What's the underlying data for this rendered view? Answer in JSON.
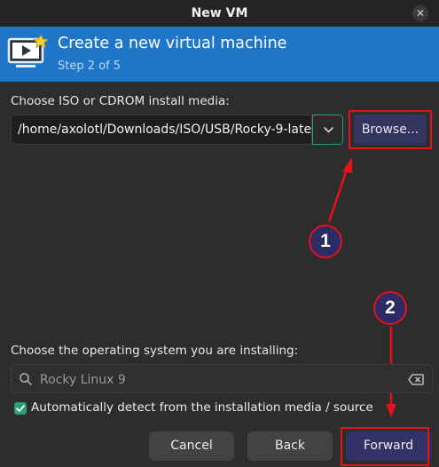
{
  "window": {
    "title": "New VM"
  },
  "header": {
    "title": "Create a new virtual machine",
    "step": "Step 2 of 5"
  },
  "media": {
    "label": "Choose ISO or CDROM install media:",
    "path": "/home/axolotl/Downloads/ISO/USB/Rocky-9-late",
    "browse_label": "Browse..."
  },
  "os": {
    "label": "Choose the operating system you are installing:",
    "search_placeholder": "Rocky Linux 9",
    "auto_detect_label": "Automatically detect from the installation media / source",
    "auto_detect_checked": true
  },
  "buttons": {
    "cancel": "Cancel",
    "back": "Back",
    "forward": "Forward"
  },
  "annotations": {
    "step1": "1",
    "step2": "2"
  },
  "colors": {
    "header_bg": "#1f76c8",
    "accent_green": "#2e9e77",
    "annotation_red": "#e8101a",
    "annotation_badge": "#2c2b66"
  },
  "icons": [
    "close-icon",
    "vm-monitor-icon",
    "chevron-down-icon",
    "search-icon",
    "clear-icon",
    "check-icon"
  ]
}
